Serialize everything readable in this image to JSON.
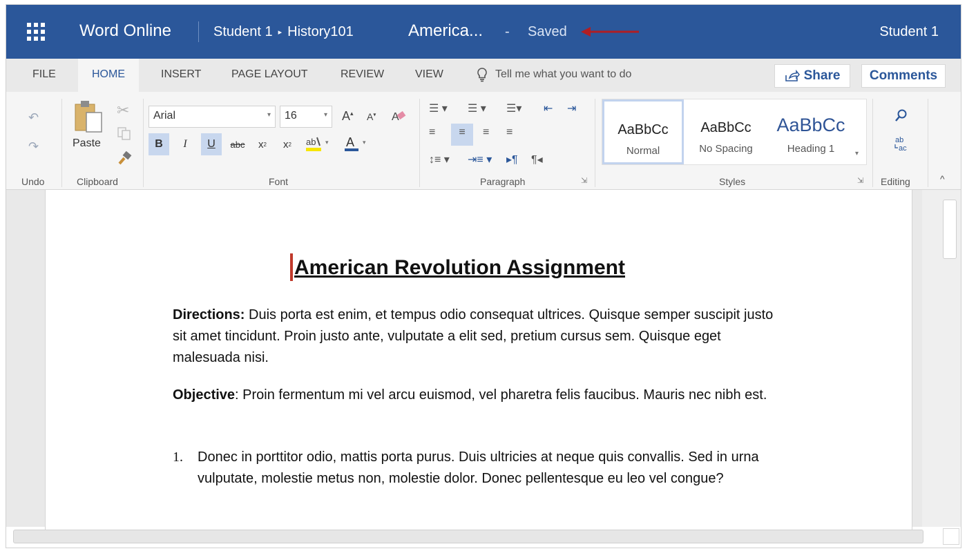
{
  "titlebar": {
    "app_name": "Word Online",
    "breadcrumb_owner": "Student 1",
    "breadcrumb_separator": "▸",
    "breadcrumb_folder": "History101",
    "doc_name": "America...",
    "save_dash": "-",
    "save_status": "Saved",
    "user": "Student 1",
    "arrow_color": "#b01e23",
    "bar_color": "#2b579a"
  },
  "tabs": [
    "FILE",
    "HOME",
    "INSERT",
    "PAGE LAYOUT",
    "REVIEW",
    "VIEW"
  ],
  "tell_me": "Tell me what you want to do",
  "share_label": "Share",
  "comments_label": "Comments",
  "ribbon": {
    "undo_label": "Undo",
    "clipboard_label": "Clipboard",
    "paste_label": "Paste",
    "font_label": "Font",
    "font_name": "Arial",
    "font_size": "16",
    "paragraph_label": "Paragraph",
    "styles_label": "Styles",
    "editing_label": "Editing",
    "styles": [
      {
        "preview": "AaBbCc",
        "name": "Normal"
      },
      {
        "preview": "AaBbCc",
        "name": "No Spacing"
      },
      {
        "preview": "AaBbCc",
        "name": "Heading 1"
      }
    ]
  },
  "document": {
    "title": "American Revolution Assignment",
    "directions_label": "Directions:",
    "directions_text": " Duis porta est enim, et tempus odio consequat ultrices. Quisque semper suscipit justo sit amet tincidunt. Proin justo ante, vulputate a elit sed, pretium cursus sem. Quisque eget malesuada nisi.",
    "objective_label": "Objective",
    "objective_text": ": Proin fermentum mi vel arcu euismod, vel pharetra felis faucibus. Mauris nec nibh est.",
    "list": [
      {
        "num": "1.",
        "text": "Donec in porttitor odio, mattis porta purus. Duis ultricies at neque quis convallis. Sed in urna vulputate, molestie metus non, molestie dolor. Donec pellentesque eu leo vel congue?"
      }
    ]
  }
}
